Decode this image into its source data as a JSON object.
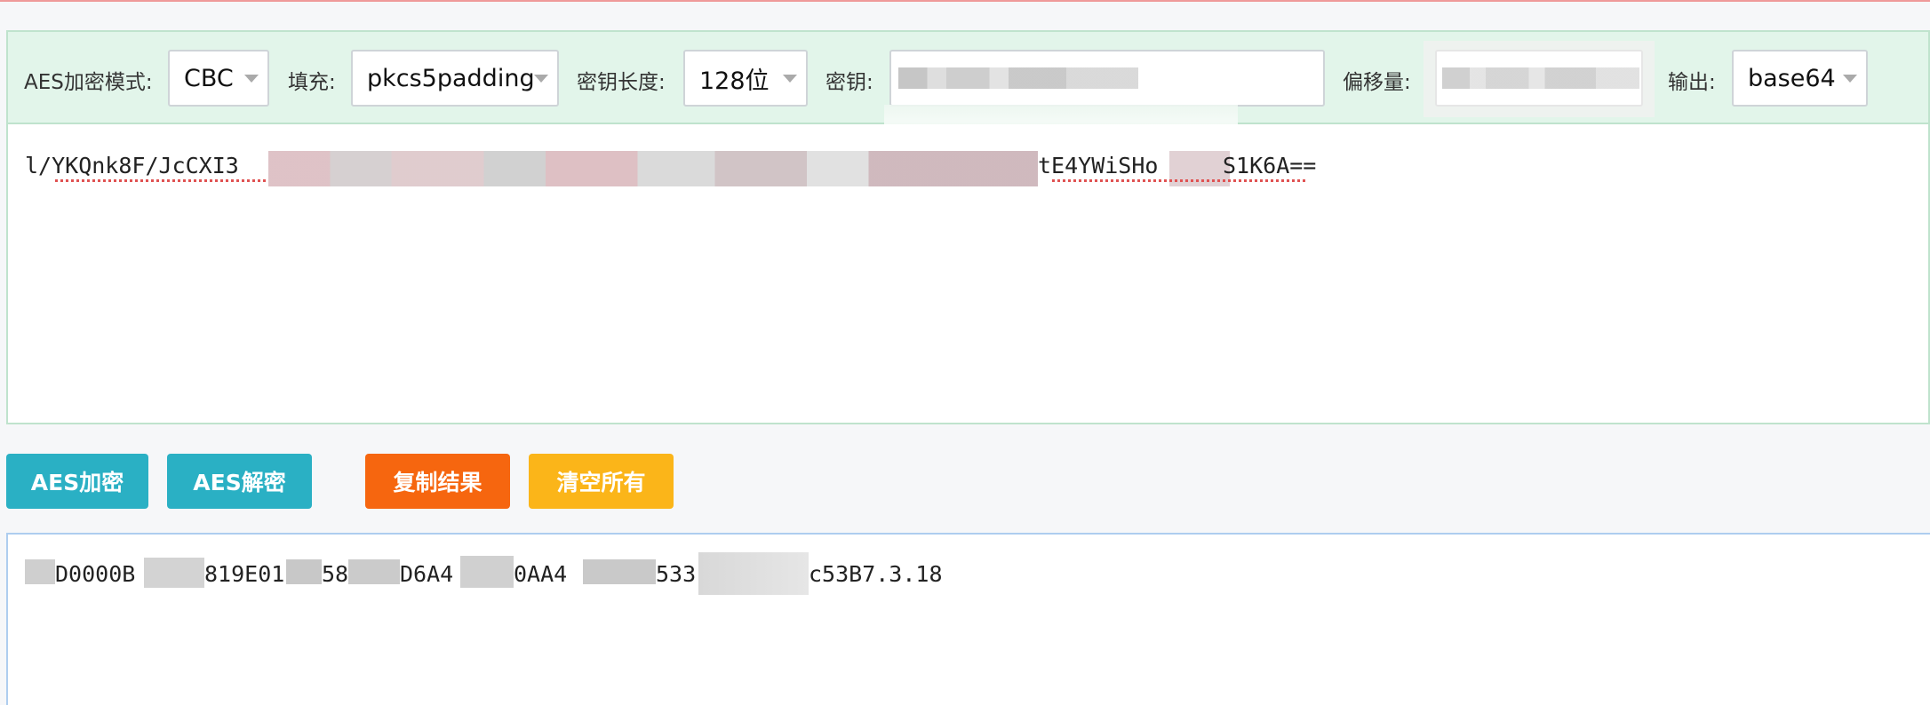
{
  "toolbar": {
    "mode_label": "AES加密模式:",
    "mode_value": "CBC",
    "padding_label": "填充:",
    "padding_value": "pkcs5padding",
    "keylen_label": "密钥长度:",
    "keylen_value": "128位",
    "key_label": "密钥:",
    "key_value": "",
    "iv_label": "偏移量:",
    "iv_value": "",
    "output_label": "输出:",
    "output_value": "base64"
  },
  "input": {
    "visible_start": "l/YKQnk8F/JcCXI3",
    "visible_end": "tE4YWiSHo",
    "visible_tail": "S1K6A=="
  },
  "buttons": {
    "encrypt": "AES加密",
    "decrypt": "AES解密",
    "copy": "复制结果",
    "clear": "清空所有"
  },
  "output": {
    "segments": [
      "D0000B",
      "819E01",
      "58",
      "D6A4",
      "0AA4",
      "533",
      "c53B7.3.18"
    ]
  },
  "colors": {
    "encrypt_btn": "#2ab0c4",
    "decrypt_btn": "#2ab0c4",
    "copy_btn": "#f6660f",
    "clear_btn": "#fbb519",
    "toolbar_bg": "#e2f5ea",
    "output_border": "#aecdef"
  }
}
